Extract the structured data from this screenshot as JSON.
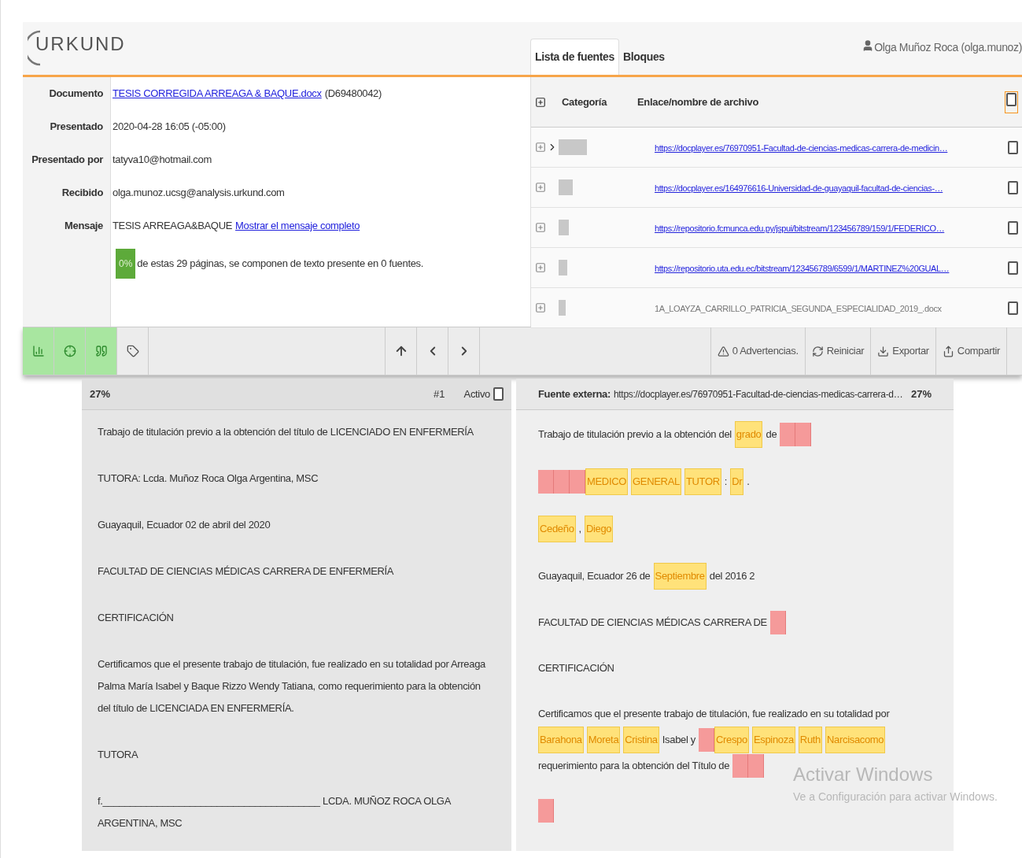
{
  "logo": {
    "text": "URKUND"
  },
  "info": [
    {
      "label": "Documento",
      "parts": [
        {
          "kind": "link",
          "text": "TESIS CORREGIDA ARREAGA & BAQUE.docx"
        },
        {
          "kind": "text",
          "text": "(D69480042)"
        }
      ]
    },
    {
      "label": "Presentado",
      "parts": [
        {
          "kind": "text",
          "text": "2020-04-28 16:05 (-05:00)"
        }
      ]
    },
    {
      "label": "Presentado por",
      "parts": [
        {
          "kind": "text",
          "text": "tatyva10@hotmail.com"
        }
      ]
    },
    {
      "label": "Recibido",
      "parts": [
        {
          "kind": "text",
          "text": "olga.munoz.ucsg@analysis.urkund.com"
        }
      ]
    },
    {
      "label": "Mensaje",
      "parts": [
        {
          "kind": "text",
          "text": "TESIS ARREAGA&BAQUE"
        },
        {
          "kind": "link",
          "text": "Mostrar el mensaje completo"
        }
      ]
    }
  ],
  "summary": {
    "badge": "0%",
    "text": "de estas 29 páginas, se componen de texto presente en 0 fuentes."
  },
  "tabs": [
    {
      "label": "Lista de fuentes",
      "selected": true
    },
    {
      "label": "Bloques",
      "selected": false
    }
  ],
  "user": "Olga Muñoz Roca (olga.munoz)",
  "sources": {
    "columns": [
      "Categoría",
      "Enlace/nombre de archivo"
    ],
    "all_checked": false,
    "rows": [
      {
        "expanded": true,
        "kind": "link",
        "text": "https://docplayer.es/76970951-Facultad-de-ciencias-medicas-carrera-de-medicin…",
        "checked": false
      },
      {
        "expanded": false,
        "kind": "link",
        "text": "https://docplayer.es/164976616-Universidad-de-guayaquil-facultad-de-ciencias-…",
        "checked": false
      },
      {
        "expanded": false,
        "kind": "link",
        "text": "https://repositorio.fcmunca.edu.py/jspui/bitstream/123456789/159/1/FEDERICO…",
        "checked": false
      },
      {
        "expanded": false,
        "kind": "link",
        "text": "https://repositorio.uta.edu.ec/bitstream/123456789/6599/1/MARTINEZ%20GUAL…",
        "checked": false
      },
      {
        "expanded": false,
        "kind": "file",
        "text": "1A_LOAYZA_CARRILLO_PATRICIA_SEGUNDA_ESPECIALIDAD_2019_.docx",
        "checked": false
      }
    ]
  },
  "toolbar": {
    "views": [
      {
        "kind": "chart",
        "selected": true
      },
      {
        "kind": "target",
        "selected": true
      },
      {
        "kind": "quote",
        "selected": true
      },
      {
        "kind": "tag",
        "selected": false
      }
    ],
    "nav": [
      {
        "kind": "up"
      },
      {
        "kind": "prev"
      },
      {
        "kind": "next"
      }
    ],
    "actions": [
      {
        "kind": "warning",
        "label": "0 Advertencias."
      },
      {
        "kind": "reset",
        "label": "Reiniciar"
      },
      {
        "kind": "export",
        "label": "Exportar"
      },
      {
        "kind": "share",
        "label": "Compartir"
      }
    ]
  },
  "document": {
    "percent": "27%",
    "index": "#1",
    "active_label": "Activo",
    "active": false,
    "paragraphs": [
      "Trabajo de titulación previo a la obtención del título de LICENCIADO EN ENFERMERÍA",
      "TUTORA: Lcda. Muñoz Roca Olga Argentina, MSC",
      "Guayaquil, Ecuador 02 de abril del 2020",
      "FACULTAD DE CIENCIAS MÉDICAS CARRERA DE ENFERMERÍA",
      "CERTIFICACIÓN",
      "Certificamos que el presente trabajo de titulación, fue realizado en su totalidad por Arreaga Palma María Isabel y Baque Rizzo Wendy Tatiana, como requerimiento para la obtención del título de LICENCIADA EN ENFERMERÍA.",
      "TUTORA",
      "f.________________________________________ LCDA. MUÑOZ ROCA OLGA ARGENTINA, MSC"
    ]
  },
  "source_view": {
    "label": "Fuente externa:",
    "url": "https://docplayer.es/76970951-Facultad-de-ciencias-medicas-carrera-d…",
    "percent": "27%",
    "paragraphs": [
      [
        {
          "kind": "text",
          "text": "Trabajo de titulación previo a la obtención del"
        },
        {
          "kind": "match",
          "text": "grado"
        },
        {
          "kind": "text",
          "text": "de"
        },
        {
          "kind": "blank"
        },
        {
          "kind": "blank"
        }
      ],
      [
        {
          "kind": "blank"
        },
        {
          "kind": "blank"
        },
        {
          "kind": "blank"
        },
        {
          "kind": "match",
          "text": "MEDICO"
        },
        {
          "kind": "match",
          "text": "GENERAL"
        },
        {
          "kind": "match",
          "text": "TUTOR"
        },
        {
          "kind": "text",
          "text": ":"
        },
        {
          "kind": "match",
          "text": "Dr"
        },
        {
          "kind": "text",
          "text": "."
        }
      ],
      [
        {
          "kind": "match",
          "text": "Cedeño"
        },
        {
          "kind": "text",
          "text": ","
        },
        {
          "kind": "match",
          "text": "Diego"
        }
      ],
      [
        {
          "kind": "text",
          "text": "Guayaquil, Ecuador 26 de"
        },
        {
          "kind": "match",
          "text": "Septiembre"
        },
        {
          "kind": "text",
          "text": "del 2016 2"
        }
      ],
      [
        {
          "kind": "text",
          "text": "FACULTAD DE CIENCIAS MÉDICAS CARRERA DE"
        },
        {
          "kind": "blank"
        }
      ],
      [
        {
          "kind": "text",
          "text": "CERTIFICACIÓN"
        }
      ],
      [
        {
          "kind": "text",
          "text": "Certificamos que el presente trabajo de titulación, fue realizado en su totalidad por"
        },
        {
          "kind": "match",
          "text": "Barahona"
        },
        {
          "kind": "match",
          "text": "Moreta"
        },
        {
          "kind": "match",
          "text": "Cristina"
        },
        {
          "kind": "text",
          "text": "Isabel y"
        },
        {
          "kind": "blank"
        },
        {
          "kind": "match",
          "text": "Crespo"
        },
        {
          "kind": "match",
          "text": "Espinoza"
        },
        {
          "kind": "match",
          "text": "Ruth"
        },
        {
          "kind": "match",
          "text": "Narcisacomo"
        },
        {
          "kind": "text",
          "text": "requerimiento para la obtención del Título de"
        },
        {
          "kind": "blank"
        },
        {
          "kind": "blank"
        }
      ],
      [
        {
          "kind": "blank"
        }
      ]
    ]
  },
  "os_notice": {
    "title": "Activar Windows",
    "text": "Ve a Configuración para activar Windows."
  }
}
